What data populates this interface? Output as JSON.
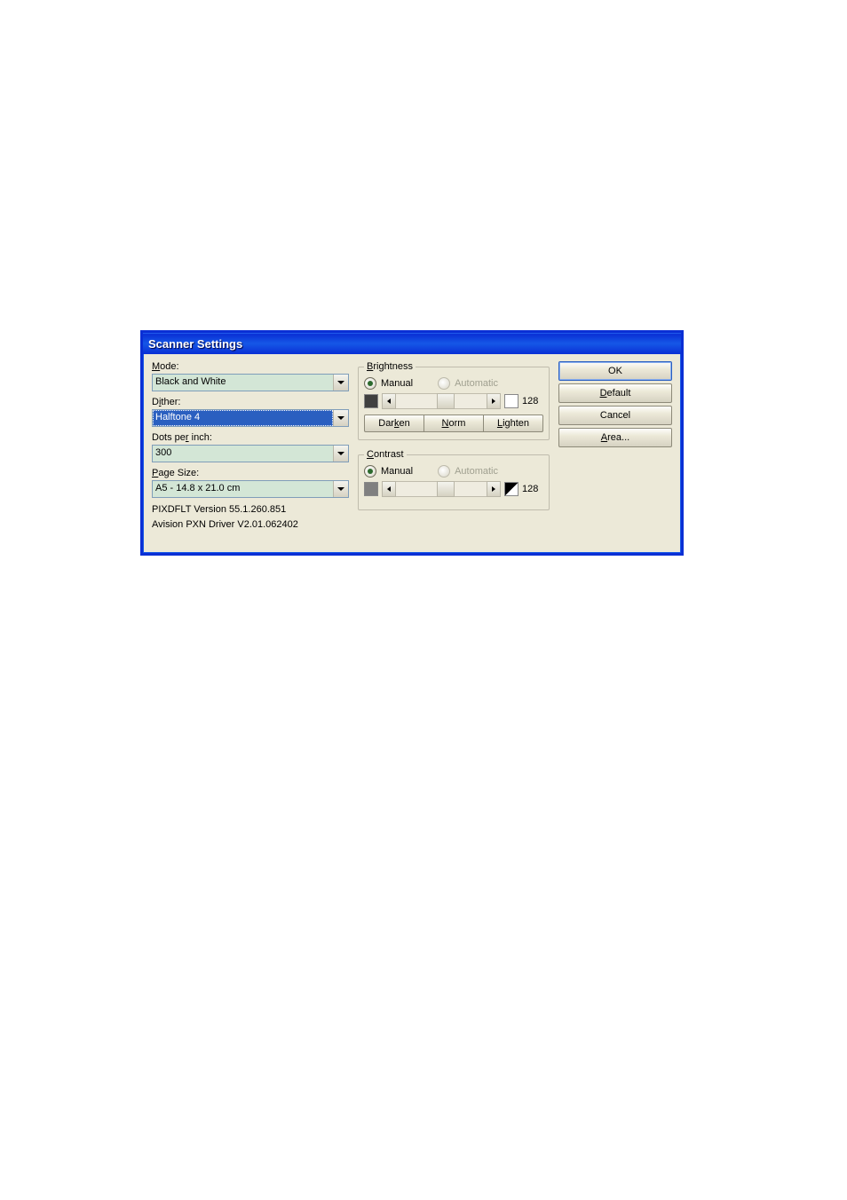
{
  "dialog": {
    "title": "Scanner Settings",
    "left": {
      "mode_label": "Mode:",
      "mode_value": "Black and White",
      "dither_label": "Dither:",
      "dither_value": "Halftone 4",
      "dpi_label": "Dots per inch:",
      "dpi_value": "300",
      "page_label": "Page Size:",
      "page_value": "A5 - 14.8 x 21.0 cm",
      "version_line1": "PIXDFLT Version 55.1.260.851",
      "version_line2": "Avision PXN Driver V2.01.062402"
    },
    "brightness": {
      "legend": "Brightness",
      "manual": "Manual",
      "automatic": "Automatic",
      "value": "128",
      "darken": "Darken",
      "norm": "Norm",
      "lighten": "Lighten"
    },
    "contrast": {
      "legend": "Contrast",
      "manual": "Manual",
      "automatic": "Automatic",
      "value": "128"
    },
    "buttons": {
      "ok": "OK",
      "default": "Default",
      "cancel": "Cancel",
      "area": "Area..."
    }
  }
}
